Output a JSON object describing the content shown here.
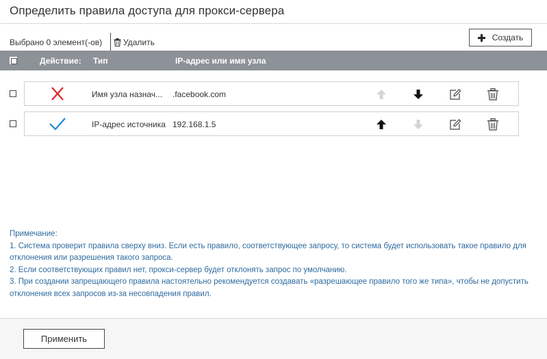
{
  "page": {
    "title": "Определить правила доступа для прокси-сервера"
  },
  "toolbar": {
    "selected_text": "Выбрано 0 элемент(-ов)",
    "delete_label": "Удалить",
    "create_label": "Создать"
  },
  "table": {
    "headers": {
      "action": "Действие:",
      "type": "Тип",
      "address": "IP-адрес или имя узла"
    },
    "rows": [
      {
        "action": "deny",
        "action_icon": "red-cross-icon",
        "type": "Имя узла назнач...",
        "address": ".facebook.com",
        "move_up_enabled": false,
        "move_down_enabled": true
      },
      {
        "action": "allow",
        "action_icon": "blue-check-icon",
        "type": "IP-адрес источника",
        "address": "192.168.1.5",
        "move_up_enabled": true,
        "move_down_enabled": false
      }
    ]
  },
  "note": {
    "heading": "Примечание:",
    "lines": [
      "1. Система проверит правила сверху вниз. Если есть правило, соответствующее запросу, то система будет использовать такое правило для отклонения или разрешения такого запроса.",
      "2. Если соответствующих правил нет, прокси-сервер будет отклонять запрос по умолчанию.",
      "3. При создании запрещающего правила настоятельно рекомендуется создавать «разрешающее правило того же типа», чтобы не допустить отклонения всех запросов из-за несовпадения правил."
    ]
  },
  "footer": {
    "apply_label": "Применить"
  },
  "colors": {
    "header_bg": "#8d9198",
    "note_text": "#2d6a9f",
    "deny_icon": "#e0242a",
    "allow_icon": "#1e88d6",
    "enabled_arrow": "#111111",
    "disabled_arrow": "#d4d4d4"
  }
}
